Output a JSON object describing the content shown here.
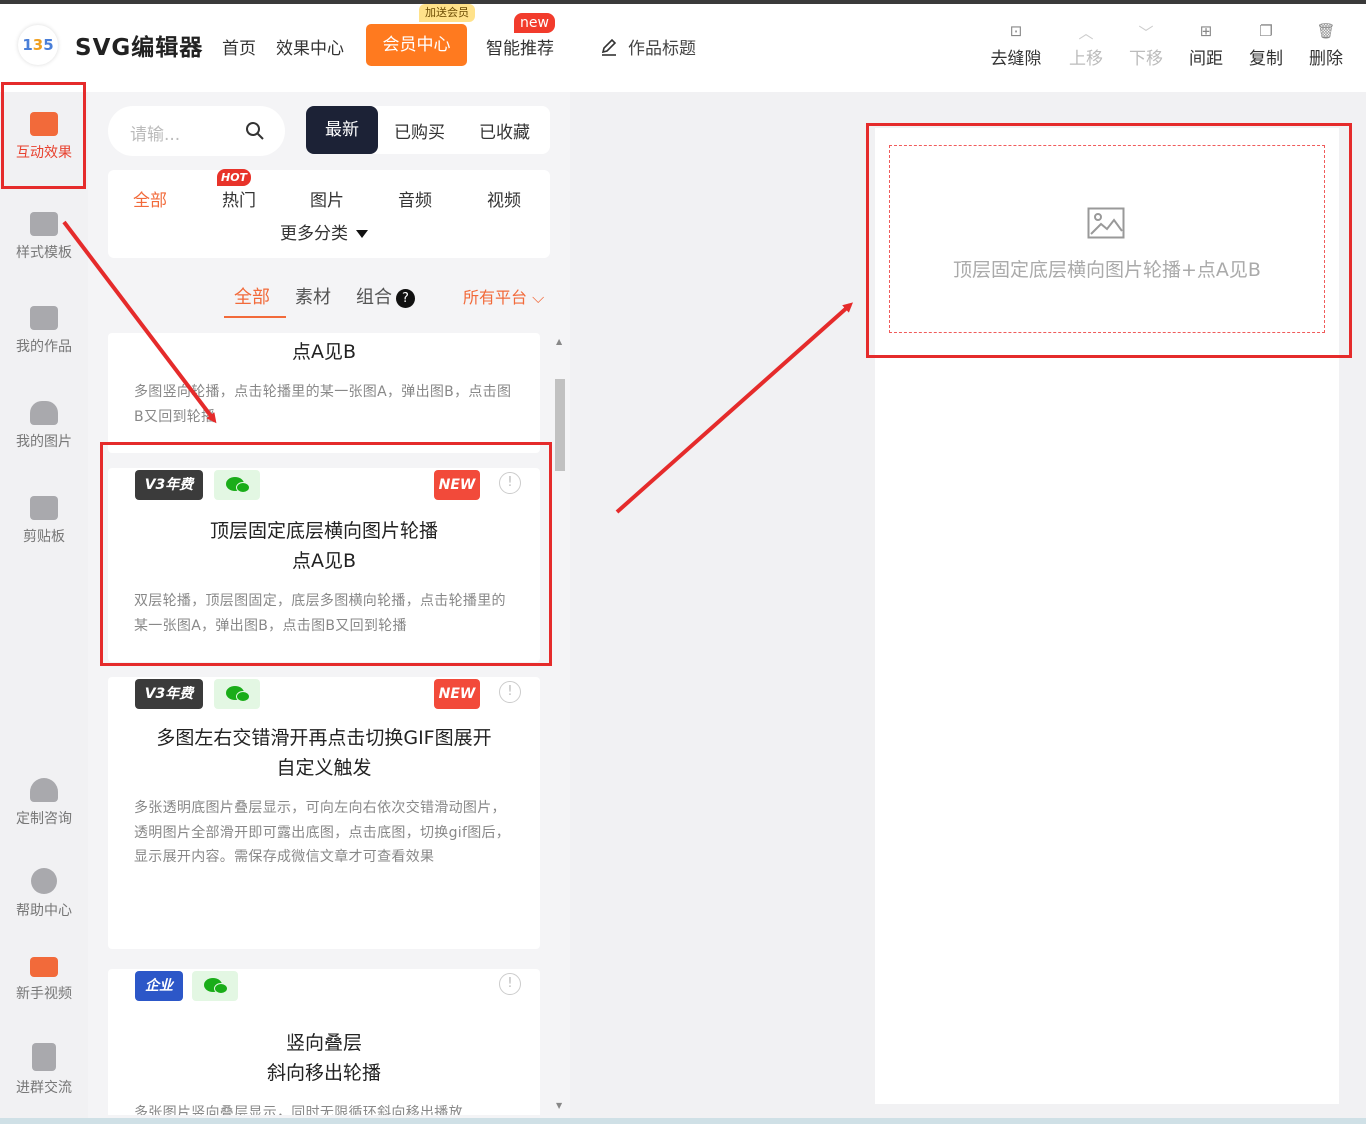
{
  "header": {
    "logo_text_a": "1",
    "logo_text_b": "3",
    "logo_text_c": "5",
    "brand": "SVG编辑器",
    "nav_home": "首页",
    "nav_effects": "效果中心",
    "member_center": "会员中心",
    "member_badge": "加送会员",
    "smart_recommend": "智能推荐",
    "new_badge": "new",
    "work_title": "作品标题",
    "tools": {
      "remove_gap": "去缝隙",
      "move_up": "上移",
      "move_down": "下移",
      "spacing": "间距",
      "copy": "复制",
      "delete": "删除"
    }
  },
  "sidebar": {
    "items": [
      {
        "label": "互动效果",
        "active": true
      },
      {
        "label": "样式模板"
      },
      {
        "label": "我的作品"
      },
      {
        "label": "我的图片"
      },
      {
        "label": "剪贴板"
      },
      {
        "label": "定制咨询"
      },
      {
        "label": "帮助中心"
      },
      {
        "label": "新手视频"
      },
      {
        "label": "进群交流"
      }
    ]
  },
  "panel": {
    "search_placeholder": "请输...",
    "tabs": {
      "latest": "最新",
      "purchased": "已购买",
      "favorited": "已收藏"
    },
    "categories": {
      "all": "全部",
      "hot": "热门",
      "image": "图片",
      "audio": "音频",
      "video": "视频",
      "more": "更多分类",
      "hot_badge": "HOT"
    },
    "subtabs": {
      "all": "全部",
      "material": "素材",
      "combo": "组合",
      "help": "?",
      "platform": "所有平台"
    },
    "cards": [
      {
        "title_lines": [
          "点A见B"
        ],
        "desc": "多图竖向轮播，点击轮播里的某一张图A，弹出图B，点击图B又回到轮播"
      },
      {
        "tag": "V3年费",
        "new_tag": "NEW",
        "title_lines": [
          "顶层固定底层横向图片轮播",
          "点A见B"
        ],
        "desc": "双层轮播，顶层图固定，底层多图横向轮播，点击轮播里的某一张图A，弹出图B，点击图B又回到轮播"
      },
      {
        "tag": "V3年费",
        "new_tag": "NEW",
        "title_lines": [
          "多图左右交错滑开再点击切换GIF图展开",
          "自定义触发"
        ],
        "desc": "多张透明底图片叠层显示，可向左向右依次交错滑动图片，透明图片全部滑开即可露出底图，点击底图，切换gif图后，显示展开内容。需保存成微信文章才可查看效果"
      },
      {
        "tag": "企业",
        "title_lines": [
          "竖向叠层",
          "斜向移出轮播"
        ],
        "desc": "多张图片竖向叠层显示，同时无限循环斜向移出播放"
      }
    ]
  },
  "canvas": {
    "placeholder_text": "顶层固定底层横向图片轮播+点A见B"
  },
  "colors": {
    "accent": "#f26a3a",
    "member": "#ff7a1f",
    "highlight": "#e52b2b"
  }
}
